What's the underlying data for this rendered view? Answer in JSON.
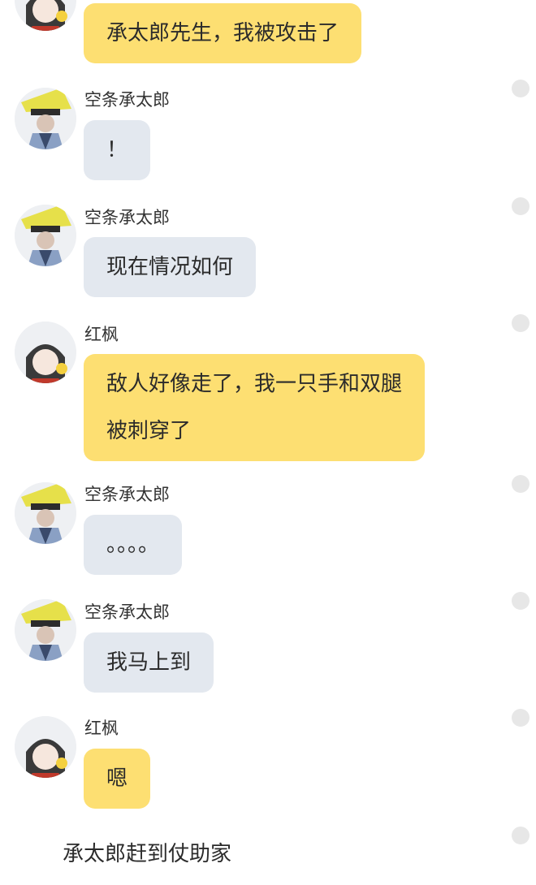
{
  "messages": [
    {
      "sender": "",
      "text": "承太郎先生，我被攻击了",
      "avatar": "kouhou-avatar",
      "color": "yellow"
    },
    {
      "sender": "空条承太郎",
      "text": "！",
      "avatar": "jotaro-avatar",
      "color": "grey"
    },
    {
      "sender": "空条承太郎",
      "text": "现在情况如何",
      "avatar": "jotaro-avatar",
      "color": "grey"
    },
    {
      "sender": "红枫",
      "text_line1": "敌人好像走了，我一只手和双腿",
      "text_line2": "被刺穿了",
      "avatar": "kouhou-avatar",
      "color": "yellow"
    },
    {
      "sender": "空条承太郎",
      "text": "。。。。",
      "avatar": "jotaro-avatar",
      "color": "grey"
    },
    {
      "sender": "空条承太郎",
      "text": "我马上到",
      "avatar": "jotaro-avatar",
      "color": "grey"
    },
    {
      "sender": "红枫",
      "text": "嗯",
      "avatar": "kouhou-avatar",
      "color": "yellow"
    }
  ],
  "narration": "承太郎赶到仗助家",
  "colors": {
    "yellow_bubble": "#fddf72",
    "grey_bubble": "#e3e8ef",
    "dot": "#e7e7e7"
  }
}
